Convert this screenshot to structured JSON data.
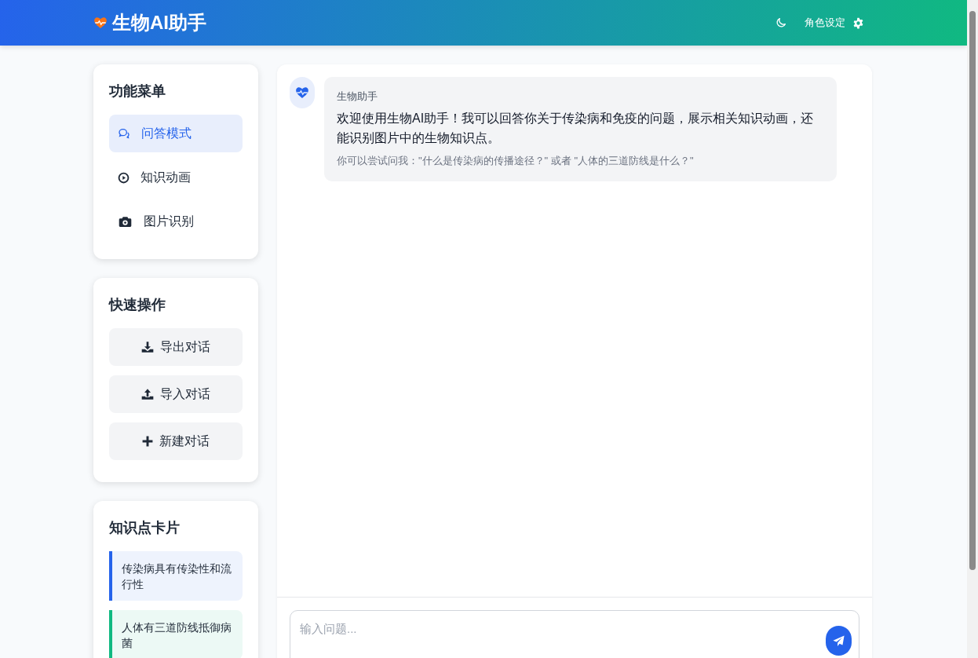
{
  "header": {
    "title": "生物AI助手",
    "role_button": "角色设定"
  },
  "menu": {
    "title": "功能菜单",
    "items": [
      {
        "label": "问答模式",
        "kind": "chat",
        "selected": true
      },
      {
        "label": "知识动画",
        "kind": "play",
        "selected": false
      },
      {
        "label": "图片识别",
        "kind": "camera",
        "selected": false
      }
    ]
  },
  "quick_actions": {
    "title": "快速操作",
    "buttons": [
      {
        "label": "导出对话",
        "kind": "download"
      },
      {
        "label": "导入对话",
        "kind": "upload"
      },
      {
        "label": "新建对话",
        "kind": "plus"
      }
    ]
  },
  "knowledge_cards": {
    "title": "知识点卡片",
    "cards": [
      {
        "text": "传染病具有传染性和流行性",
        "color": "#2563eb"
      },
      {
        "text": "人体有三道防线抵御病菌",
        "color": "#10b981"
      }
    ]
  },
  "messages": [
    {
      "sender": "生物助手",
      "text": "欢迎使用生物AI助手！我可以回答你关于传染病和免疫的问题，展示相关知识动画，还能识别图片中的生物知识点。",
      "hint": "你可以尝试问我：\"什么是传染病的传播途径？\" 或者 \"人体的三道防线是什么？\""
    }
  ],
  "input": {
    "placeholder": "输入问题..."
  }
}
